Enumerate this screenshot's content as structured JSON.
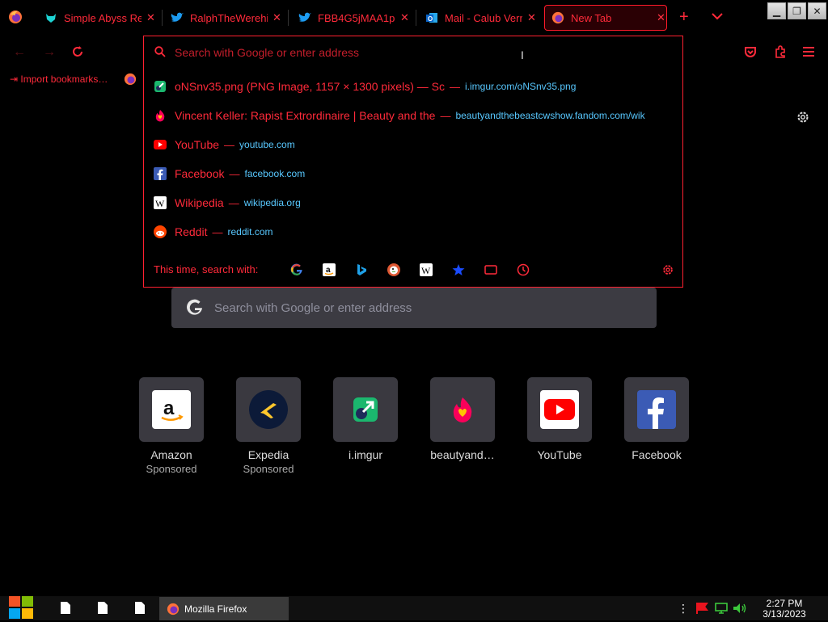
{
  "tabs": [
    {
      "title": "Simple Abyss Re",
      "icon": "dog-icon",
      "color": "#1dd3d3"
    },
    {
      "title": "RalphTheWerehi",
      "icon": "twitter-icon",
      "color": "#1d9bf0"
    },
    {
      "title": "FBB4G5jMAA1p",
      "icon": "twitter-icon",
      "color": "#1d9bf0"
    },
    {
      "title": "Mail - Calub Verr",
      "icon": "outlook-icon",
      "color": "#0a64c8"
    },
    {
      "title": "New Tab",
      "icon": "firefox-icon",
      "active": true
    }
  ],
  "urlbar": {
    "placeholder": "Search with Google or enter address"
  },
  "suggestions": [
    {
      "title": "oNSnv35.png (PNG Image, 1157 × 1300 pixels) — Sc",
      "url": "i.imgur.com/oNSnv35.png",
      "icon": "imgur-icon"
    },
    {
      "title": "Vincent Keller: Rapist Extrordinaire | Beauty and the",
      "url": "beautyandthebeastcwshow.fandom.com/wik",
      "icon": "fandom-icon"
    },
    {
      "title": "YouTube",
      "url": "youtube.com",
      "icon": "youtube-icon"
    },
    {
      "title": "Facebook",
      "url": "facebook.com",
      "icon": "facebook-icon"
    },
    {
      "title": "Wikipedia",
      "url": "wikipedia.org",
      "icon": "wikipedia-icon"
    },
    {
      "title": "Reddit",
      "url": "reddit.com",
      "icon": "reddit-icon"
    }
  ],
  "search_with": {
    "label": "This time, search with:",
    "engines": [
      "google-icon",
      "amazon-icon",
      "bing-icon",
      "duckduckgo-icon",
      "wikipedia-icon",
      "bookmarks-icon",
      "tabs-icon",
      "history-icon"
    ]
  },
  "bookmarks_bar": {
    "import_label": "Import bookmarks…"
  },
  "main_search": {
    "placeholder": "Search with Google or enter address"
  },
  "top_sites": [
    {
      "label": "Amazon",
      "sub": "Sponsored",
      "icon": "amazon-icon"
    },
    {
      "label": "Expedia",
      "sub": "Sponsored",
      "icon": "expedia-icon"
    },
    {
      "label": "i.imgur",
      "sub": "",
      "icon": "imgur-icon"
    },
    {
      "label": "beautyand…",
      "sub": "",
      "icon": "fandom-icon"
    },
    {
      "label": "YouTube",
      "sub": "",
      "icon": "youtube-icon"
    },
    {
      "label": "Facebook",
      "sub": "",
      "icon": "facebook-icon"
    }
  ],
  "taskbar": {
    "app_label": "Mozilla Firefox",
    "time": "2:27 PM",
    "date": "3/13/2023"
  },
  "colors": {
    "accent": "#ff2a3a",
    "url": "#58c8ff",
    "tile_bg": "#3a3940"
  }
}
